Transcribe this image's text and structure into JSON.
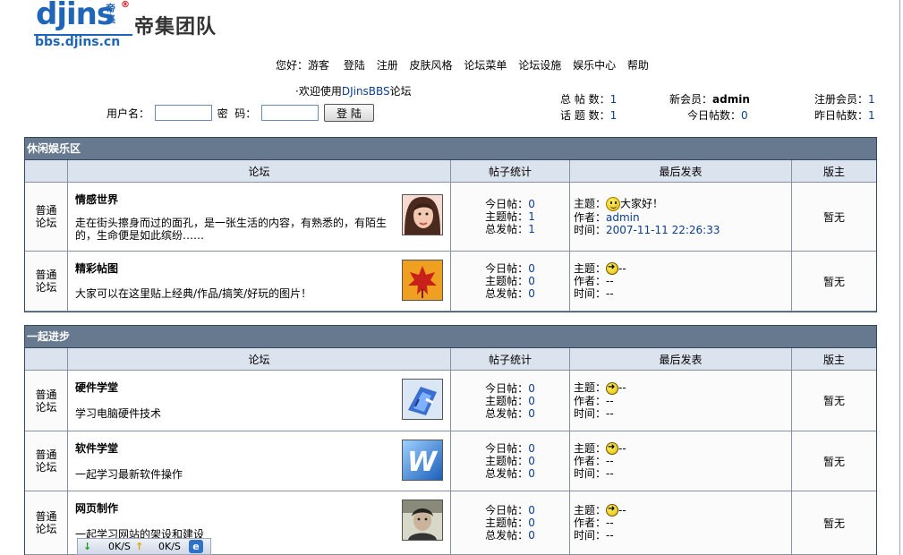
{
  "logo": {
    "main": "djins",
    "tag": "帝集",
    "reg": "®",
    "cn": "帝集团队",
    "url": "bbs.djins.cn"
  },
  "nav": {
    "greeting": "您好：游客",
    "items": [
      "登陆",
      "注册",
      "皮肤风格",
      "论坛菜单",
      "论坛设施",
      "娱乐中心",
      "帮助"
    ]
  },
  "welcome": {
    "prefix": "·欢迎使用",
    "brand": "DJinsBBS",
    "suffix": "论坛"
  },
  "login": {
    "user_label": "用户名：",
    "pass_label": "密  码：",
    "button": "登 陆",
    "user_value": "",
    "pass_value": ""
  },
  "stats": {
    "total_posts_label": "总 帖 数：",
    "total_posts": "1",
    "topics_label": "话 题 数：",
    "topics": "1",
    "new_member_label": "新会员：",
    "new_member": "admin",
    "today_label": "今日帖数：",
    "today": "0",
    "registered_label": "注册会员：",
    "registered": "1",
    "yesterday_label": "昨日帖数：",
    "yesterday": "1"
  },
  "headers": {
    "forum": "论坛",
    "count": "帖子统计",
    "last": "最后发表",
    "mod": "版主"
  },
  "labels": {
    "today": "今日帖：",
    "topics": "主题帖：",
    "total": "总发帖：",
    "subject": "主题：",
    "author": "作者：",
    "time": "时间："
  },
  "sections": [
    {
      "title": "休闲娱乐区",
      "forums": [
        {
          "type": "普通论坛",
          "name": "情感世界",
          "desc": "走在街头擦身而过的面孔，是一张生活的内容，有熟悉的，有陌生的，生命便是如此缤纷……",
          "thumb_icon": "girl-portrait-icon",
          "today": "0",
          "topics": "1",
          "total": "1",
          "last_icon": "smile-icon",
          "last_subject": "大家好！",
          "last_author": "admin",
          "last_time": "2007-11-11 22:26:33",
          "mod": "暂无"
        },
        {
          "type": "普通论坛",
          "name": "精彩帖图",
          "desc": "大家可以在这里贴上经典/作品/搞笑/好玩的图片！",
          "thumb_icon": "maple-leaf-icon",
          "today": "0",
          "topics": "0",
          "total": "0",
          "last_icon": "arrow-icon",
          "last_subject": "--",
          "last_author": "--",
          "last_time": "--",
          "mod": "暂无"
        }
      ]
    },
    {
      "title": "一起进步",
      "forums": [
        {
          "type": "普通论坛",
          "name": "硬件学堂",
          "desc": "学习电脑硬件技术",
          "thumb_icon": "hardware-icon",
          "today": "0",
          "topics": "0",
          "total": "0",
          "last_icon": "arrow-icon",
          "last_subject": "--",
          "last_author": "--",
          "last_time": "--",
          "mod": "暂无"
        },
        {
          "type": "普通论坛",
          "name": "软件学堂",
          "desc": "一起学习最新软件操作",
          "thumb_icon": "word-app-icon",
          "today": "0",
          "topics": "0",
          "total": "0",
          "last_icon": "arrow-icon",
          "last_subject": "--",
          "last_author": "--",
          "last_time": "--",
          "mod": "暂无"
        },
        {
          "type": "普通论坛",
          "name": "网页制作",
          "desc": "一起学习网站的架设和建设",
          "thumb_icon": "person-photo-icon",
          "today": "0",
          "topics": "0",
          "total": "0",
          "last_icon": "arrow-icon",
          "last_subject": "--",
          "last_author": "--",
          "last_time": "--",
          "mod": "暂无"
        }
      ]
    }
  ],
  "statusbar": {
    "down": "0K/S",
    "up": "0K/S",
    "down_icon": "download-arrow-icon",
    "up_icon": "upload-arrow-icon",
    "browser_icon": "ie-icon",
    "browser_glyph": "e"
  },
  "colors": {
    "section_header": "#66798f",
    "column_header": "#dbe3ee",
    "link_blue": "#0b3d91",
    "logo_blue": "#1f66b8"
  }
}
